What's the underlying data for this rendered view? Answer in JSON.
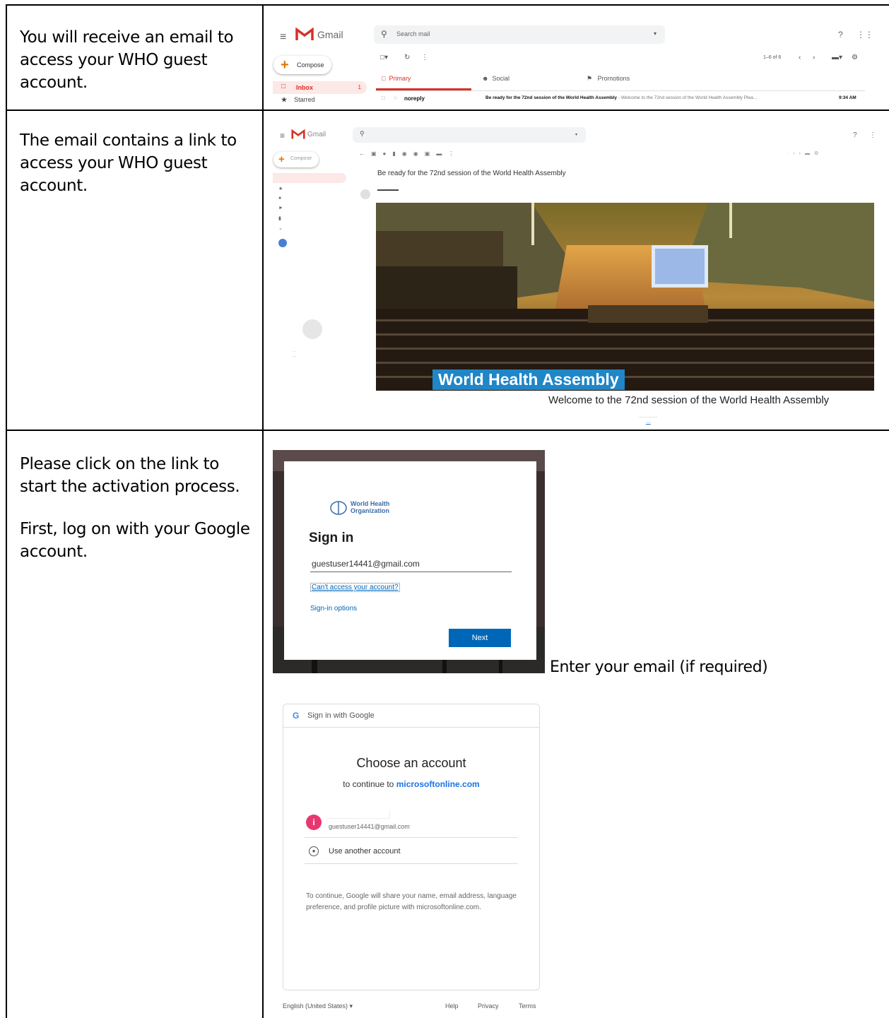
{
  "captions": {
    "row1": "You will receive an email to access your WHO guest account.",
    "row2": "The email contains a link to access your WHO guest account.",
    "row3_p1": "Please click on the link to start the activation process.",
    "row3_p2": "First, log on with your Google account.",
    "enter_email": "Enter your email (if required)"
  },
  "gmail_inbox": {
    "app_name": "Gmail",
    "search_placeholder": "Search mail",
    "compose_label": "Compose",
    "inbox_label": "Inbox",
    "inbox_count": "1",
    "starred_label": "Starred",
    "pagination": "1–6 of 6",
    "tabs": [
      "Primary",
      "Social",
      "Promotions"
    ],
    "message": {
      "sender": "noreply",
      "subject": "Be ready for the 72nd session of the World Health Assembly",
      "snippet": "- Welcome to the 72nd session of the World Health Assembly Plea...",
      "time": "9:34 AM"
    }
  },
  "gmail_message": {
    "app_name": "Gmail",
    "compose_label": "Compose",
    "subject": "Be ready for the 72nd session of the World Health Assembly",
    "banner_title": "World Health Assembly",
    "welcome_text": "Welcome to the 72nd session of the World Health Assembly"
  },
  "ms_signin": {
    "org_line1": "World Health",
    "org_line2": "Organization",
    "heading": "Sign in",
    "email_value": "guestuser14441@gmail.com",
    "cant_access": "Can't access your account?",
    "signin_options": "Sign-in options",
    "next_label": "Next"
  },
  "google_choose": {
    "header": "Sign in with Google",
    "title": "Choose an account",
    "continue_prefix": "to continue to",
    "continue_site": "microsoftonline.com",
    "account_initial": "i",
    "account_email": "guestuser14441@gmail.com",
    "use_another": "Use another account",
    "share_notice": "To continue, Google will share your name, email address, language preference, and profile picture with microsoftonline.com.",
    "language": "English (United States)",
    "help": "Help",
    "privacy": "Privacy",
    "terms": "Terms"
  }
}
